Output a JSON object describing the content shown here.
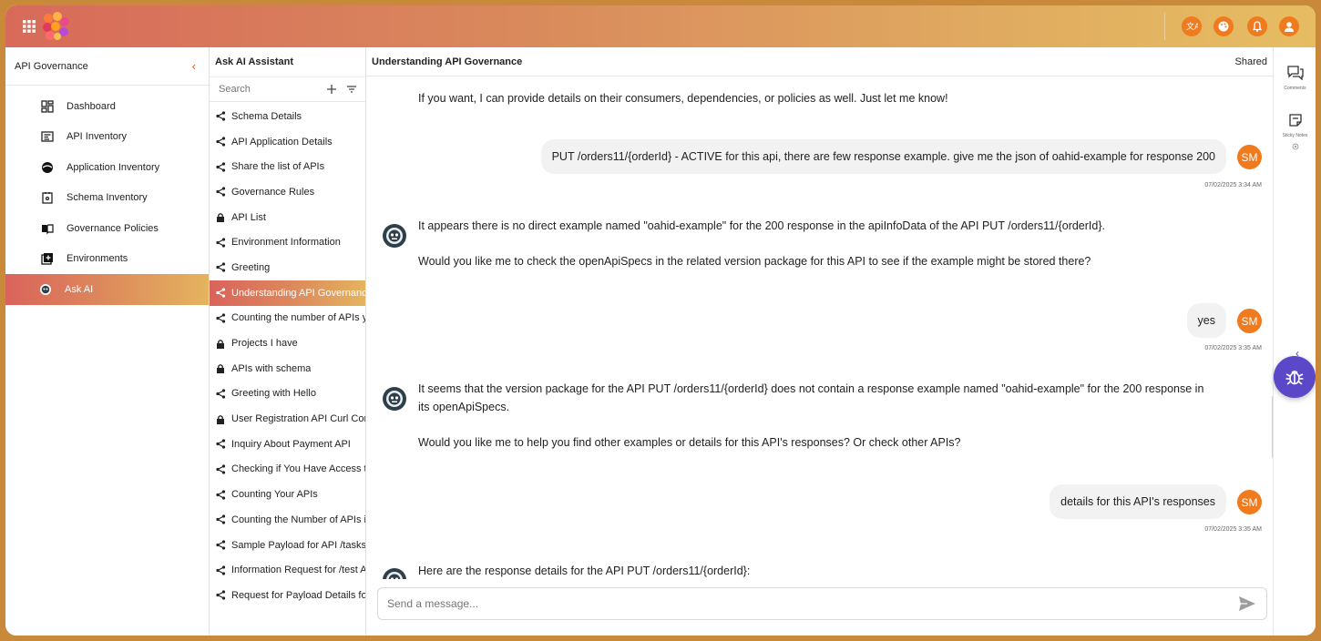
{
  "app": {
    "brand_color": "#e4572e",
    "accent_gradient": [
      "#d9635b",
      "#e4b45e"
    ]
  },
  "topbar": {
    "icons": [
      "apps-grid-icon",
      "app-logo",
      "translate-icon",
      "palette-icon",
      "bell-icon",
      "user-icon"
    ]
  },
  "nav": {
    "title": "API Governance",
    "items": [
      {
        "label": "Dashboard",
        "icon": "dashboard-icon"
      },
      {
        "label": "API Inventory",
        "icon": "api-inventory-icon"
      },
      {
        "label": "Application Inventory",
        "icon": "application-icon"
      },
      {
        "label": "Schema Inventory",
        "icon": "schema-icon"
      },
      {
        "label": "Governance Policies",
        "icon": "book-icon"
      },
      {
        "label": "Environments",
        "icon": "environment-icon"
      },
      {
        "label": "Ask AI",
        "icon": "robot-icon",
        "active": true
      }
    ]
  },
  "conversations": {
    "title": "Ask AI Assistant",
    "search_placeholder": "Search",
    "items": [
      {
        "label": "Schema Details",
        "icon": "share"
      },
      {
        "label": "API Application Details",
        "icon": "share"
      },
      {
        "label": "Share the list of APIs",
        "icon": "share"
      },
      {
        "label": "Governance Rules",
        "icon": "share"
      },
      {
        "label": "API List",
        "icon": "lock"
      },
      {
        "label": "Environment Information",
        "icon": "share"
      },
      {
        "label": "Greeting",
        "icon": "share"
      },
      {
        "label": "Understanding API Governance",
        "icon": "share",
        "active": true
      },
      {
        "label": "Counting the number of APIs y",
        "icon": "share"
      },
      {
        "label": "Projects I have",
        "icon": "lock"
      },
      {
        "label": "APIs with schema",
        "icon": "lock"
      },
      {
        "label": "Greeting with Hello",
        "icon": "share"
      },
      {
        "label": "User Registration API Curl Cor",
        "icon": "lock"
      },
      {
        "label": "Inquiry About Payment API",
        "icon": "share"
      },
      {
        "label": "Checking if You Have Access t",
        "icon": "share"
      },
      {
        "label": "Counting Your APIs",
        "icon": "share"
      },
      {
        "label": "Counting the Number of APIs i",
        "icon": "share"
      },
      {
        "label": "Sample Payload for API /tasks",
        "icon": "share"
      },
      {
        "label": "Information Request for /test A",
        "icon": "share"
      },
      {
        "label": "Request for Payload Details fo",
        "icon": "share"
      }
    ]
  },
  "chat": {
    "title": "Understanding API Governance",
    "shared_label": "Shared",
    "messages": {
      "m1": "If you want, I can provide details on their consumers, dependencies, or policies as well. Just let me know!",
      "u1": "PUT /orders11/{orderId} - ACTIVE for this api, there are few response example. give me the json of oahid-example for response 200",
      "u1_ts": "07/02/2025 3:34 AM",
      "m2a": "It appears there is no direct example named \"oahid-example\" for the 200 response in the apiInfoData of the API PUT /orders11/{orderId}.",
      "m2b": "Would you like me to check the openApiSpecs in the related version package for this API to see if the example might be stored there?",
      "u2": "yes",
      "u2_ts": "07/02/2025 3:35 AM",
      "m3a": "It seems that the version package for the API PUT /orders11/{orderId} does not contain a response example named \"oahid-example\" for the 200 response in",
      "m3b": "its openApiSpecs.",
      "m3c": "Would you like me to help you find other examples or details for this API's responses? Or check other APIs?",
      "u3": "details for this API's responses",
      "u3_ts": "07/02/2025 3:35 AM",
      "m4": "Here are the response details for the API PUT /orders11/{orderId}:"
    },
    "user_initials": "SM",
    "composer_placeholder": "Send a message..."
  },
  "rail": {
    "comments_label": "Comments",
    "sticky_label": "Sticky Notes"
  }
}
